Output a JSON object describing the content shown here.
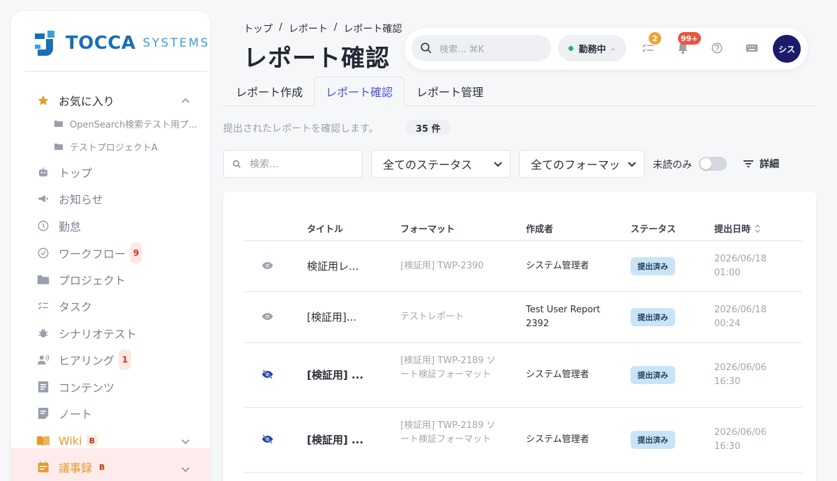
{
  "brand": {
    "name": "TOCCA",
    "sub": "SYSTEMS"
  },
  "sidebar": {
    "favorites": {
      "label": "お気に入り",
      "items": [
        "OpenSearch検索テスト用プ...",
        "テストプロジェクトA"
      ]
    },
    "items": [
      {
        "label": "トップ"
      },
      {
        "label": "お知らせ"
      },
      {
        "label": "勤怠"
      },
      {
        "label": "ワークフロー",
        "badge": "9"
      },
      {
        "label": "プロジェクト"
      },
      {
        "label": "タスク"
      },
      {
        "label": "シナリオテスト"
      },
      {
        "label": "ヒアリング",
        "badge": "1"
      },
      {
        "label": "コンテンツ"
      },
      {
        "label": "ノート"
      },
      {
        "label": "Wiki",
        "tag": "B"
      },
      {
        "label": "議事録",
        "tag": "B"
      }
    ]
  },
  "header": {
    "breadcrumb": [
      "トップ",
      "レポート",
      "レポート確認"
    ],
    "breadcrumb_sep": "/",
    "title": "レポート確認",
    "search_placeholder": "検索... ⌘K",
    "work_status": "勤務中",
    "task_badge": "2",
    "notification_badge": "99+",
    "avatar_label": "シス"
  },
  "tabs": [
    "レポート作成",
    "レポート確認",
    "レポート管理"
  ],
  "description": "提出されたレポートを確認します。",
  "count": "35 件",
  "filters": {
    "search_placeholder": "検索...",
    "status": "全てのステータス",
    "format": "全てのフォーマット",
    "unread_label": "未読のみ",
    "unread_only": false,
    "detail_label": "詳細"
  },
  "table": {
    "headers": [
      "タイトル",
      "フォーマット",
      "作成者",
      "ステータス",
      "提出日時"
    ],
    "rows": [
      {
        "read": true,
        "title": "検証用レ...",
        "format": "[検証用] TWP-2390",
        "author": "システム管理者",
        "status": "提出済み",
        "date": "2026/06/18",
        "time": "01:00"
      },
      {
        "read": true,
        "title": "[検証用]...",
        "format": "テストレポート",
        "author": "Test User Report 2392",
        "status": "提出済み",
        "date": "2026/06/18",
        "time": "00:24"
      },
      {
        "read": false,
        "title": "[検証用] ...",
        "format": "[検証用] TWP-2189 ソート検証フォーマット",
        "author": "システム管理者",
        "status": "提出済み",
        "date": "2026/06/06",
        "time": "16:30"
      },
      {
        "read": false,
        "title": "[検証用] ...",
        "format": "[検証用] TWP-2189 ソート検証フォーマット",
        "author": "システム管理者",
        "status": "提出済み",
        "date": "2026/06/06",
        "time": "16:30"
      }
    ]
  },
  "colors": {
    "accent": "#4b4fd9",
    "brand": "#1a6fb5",
    "status_bg": "#c9e4f7",
    "avatar_bg": "#1b1a6b"
  }
}
